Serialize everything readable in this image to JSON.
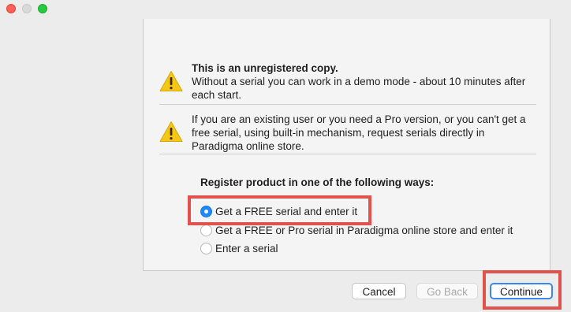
{
  "window": {
    "controls": [
      "close-button",
      "minimize-button",
      "zoom-button"
    ]
  },
  "notices": [
    {
      "icon": "warning-icon",
      "title": "This is an unregistered copy.",
      "body": "Without a serial you can work in a demo mode - about 10 minutes after each start."
    },
    {
      "icon": "warning-icon",
      "title": "",
      "body": "If you are an existing user or you need a Pro version, or you can't get a free serial, using built-in mechanism, request serials directly in Paradigma online store."
    }
  ],
  "register": {
    "heading": "Register product in one of the following ways:",
    "options": [
      {
        "label": "Get a FREE serial and enter it",
        "selected": true
      },
      {
        "label": "Get a FREE or Pro serial in Paradigma online store and enter it",
        "selected": false
      },
      {
        "label": "Enter a serial",
        "selected": false
      }
    ]
  },
  "buttons": {
    "cancel": "Cancel",
    "back": "Go Back",
    "continue": "Continue"
  },
  "colors": {
    "highlight": "#e0524b",
    "accent": "#1f87ff",
    "warning": "#f5c518"
  }
}
